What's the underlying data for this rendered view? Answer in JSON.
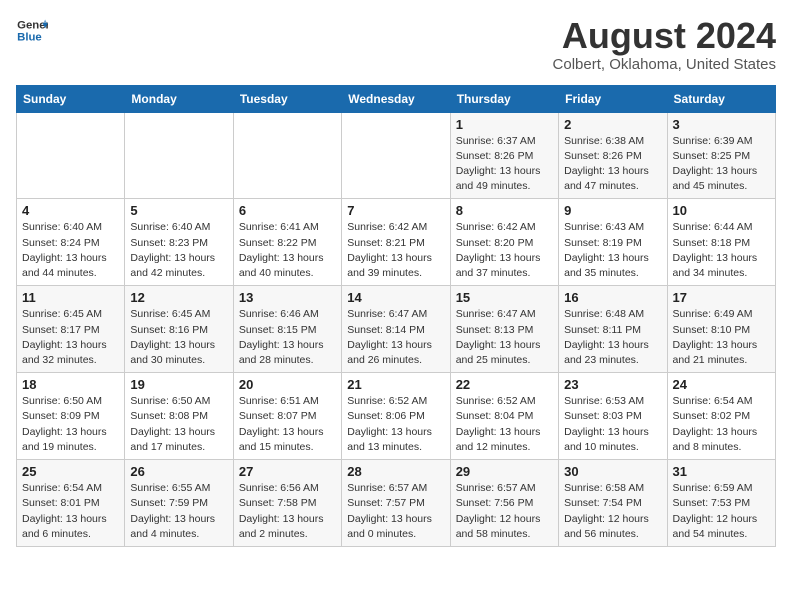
{
  "header": {
    "logo_line1": "General",
    "logo_line2": "Blue",
    "title": "August 2024",
    "subtitle": "Colbert, Oklahoma, United States"
  },
  "weekdays": [
    "Sunday",
    "Monday",
    "Tuesday",
    "Wednesday",
    "Thursday",
    "Friday",
    "Saturday"
  ],
  "weeks": [
    [
      {
        "day": "",
        "info": ""
      },
      {
        "day": "",
        "info": ""
      },
      {
        "day": "",
        "info": ""
      },
      {
        "day": "",
        "info": ""
      },
      {
        "day": "1",
        "info": "Sunrise: 6:37 AM\nSunset: 8:26 PM\nDaylight: 13 hours\nand 49 minutes."
      },
      {
        "day": "2",
        "info": "Sunrise: 6:38 AM\nSunset: 8:26 PM\nDaylight: 13 hours\nand 47 minutes."
      },
      {
        "day": "3",
        "info": "Sunrise: 6:39 AM\nSunset: 8:25 PM\nDaylight: 13 hours\nand 45 minutes."
      }
    ],
    [
      {
        "day": "4",
        "info": "Sunrise: 6:40 AM\nSunset: 8:24 PM\nDaylight: 13 hours\nand 44 minutes."
      },
      {
        "day": "5",
        "info": "Sunrise: 6:40 AM\nSunset: 8:23 PM\nDaylight: 13 hours\nand 42 minutes."
      },
      {
        "day": "6",
        "info": "Sunrise: 6:41 AM\nSunset: 8:22 PM\nDaylight: 13 hours\nand 40 minutes."
      },
      {
        "day": "7",
        "info": "Sunrise: 6:42 AM\nSunset: 8:21 PM\nDaylight: 13 hours\nand 39 minutes."
      },
      {
        "day": "8",
        "info": "Sunrise: 6:42 AM\nSunset: 8:20 PM\nDaylight: 13 hours\nand 37 minutes."
      },
      {
        "day": "9",
        "info": "Sunrise: 6:43 AM\nSunset: 8:19 PM\nDaylight: 13 hours\nand 35 minutes."
      },
      {
        "day": "10",
        "info": "Sunrise: 6:44 AM\nSunset: 8:18 PM\nDaylight: 13 hours\nand 34 minutes."
      }
    ],
    [
      {
        "day": "11",
        "info": "Sunrise: 6:45 AM\nSunset: 8:17 PM\nDaylight: 13 hours\nand 32 minutes."
      },
      {
        "day": "12",
        "info": "Sunrise: 6:45 AM\nSunset: 8:16 PM\nDaylight: 13 hours\nand 30 minutes."
      },
      {
        "day": "13",
        "info": "Sunrise: 6:46 AM\nSunset: 8:15 PM\nDaylight: 13 hours\nand 28 minutes."
      },
      {
        "day": "14",
        "info": "Sunrise: 6:47 AM\nSunset: 8:14 PM\nDaylight: 13 hours\nand 26 minutes."
      },
      {
        "day": "15",
        "info": "Sunrise: 6:47 AM\nSunset: 8:13 PM\nDaylight: 13 hours\nand 25 minutes."
      },
      {
        "day": "16",
        "info": "Sunrise: 6:48 AM\nSunset: 8:11 PM\nDaylight: 13 hours\nand 23 minutes."
      },
      {
        "day": "17",
        "info": "Sunrise: 6:49 AM\nSunset: 8:10 PM\nDaylight: 13 hours\nand 21 minutes."
      }
    ],
    [
      {
        "day": "18",
        "info": "Sunrise: 6:50 AM\nSunset: 8:09 PM\nDaylight: 13 hours\nand 19 minutes."
      },
      {
        "day": "19",
        "info": "Sunrise: 6:50 AM\nSunset: 8:08 PM\nDaylight: 13 hours\nand 17 minutes."
      },
      {
        "day": "20",
        "info": "Sunrise: 6:51 AM\nSunset: 8:07 PM\nDaylight: 13 hours\nand 15 minutes."
      },
      {
        "day": "21",
        "info": "Sunrise: 6:52 AM\nSunset: 8:06 PM\nDaylight: 13 hours\nand 13 minutes."
      },
      {
        "day": "22",
        "info": "Sunrise: 6:52 AM\nSunset: 8:04 PM\nDaylight: 13 hours\nand 12 minutes."
      },
      {
        "day": "23",
        "info": "Sunrise: 6:53 AM\nSunset: 8:03 PM\nDaylight: 13 hours\nand 10 minutes."
      },
      {
        "day": "24",
        "info": "Sunrise: 6:54 AM\nSunset: 8:02 PM\nDaylight: 13 hours\nand 8 minutes."
      }
    ],
    [
      {
        "day": "25",
        "info": "Sunrise: 6:54 AM\nSunset: 8:01 PM\nDaylight: 13 hours\nand 6 minutes."
      },
      {
        "day": "26",
        "info": "Sunrise: 6:55 AM\nSunset: 7:59 PM\nDaylight: 13 hours\nand 4 minutes."
      },
      {
        "day": "27",
        "info": "Sunrise: 6:56 AM\nSunset: 7:58 PM\nDaylight: 13 hours\nand 2 minutes."
      },
      {
        "day": "28",
        "info": "Sunrise: 6:57 AM\nSunset: 7:57 PM\nDaylight: 13 hours\nand 0 minutes."
      },
      {
        "day": "29",
        "info": "Sunrise: 6:57 AM\nSunset: 7:56 PM\nDaylight: 12 hours\nand 58 minutes."
      },
      {
        "day": "30",
        "info": "Sunrise: 6:58 AM\nSunset: 7:54 PM\nDaylight: 12 hours\nand 56 minutes."
      },
      {
        "day": "31",
        "info": "Sunrise: 6:59 AM\nSunset: 7:53 PM\nDaylight: 12 hours\nand 54 minutes."
      }
    ]
  ]
}
